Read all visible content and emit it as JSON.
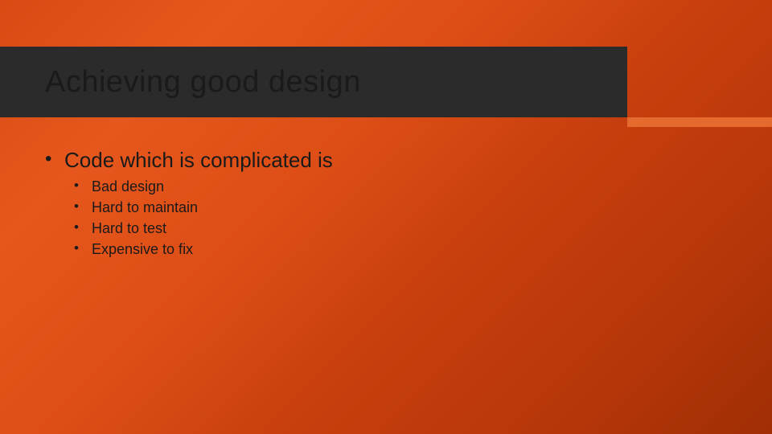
{
  "title": "Achieving good design",
  "bullets": {
    "main": "Code which is complicated is",
    "subs": [
      "Bad design",
      "Hard to maintain",
      "Hard to test",
      "Expensive to fix"
    ]
  }
}
